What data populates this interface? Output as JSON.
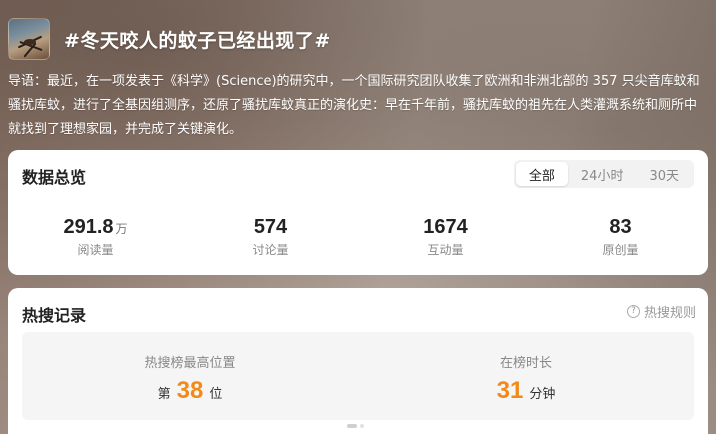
{
  "header": {
    "title": "#冬天咬人的蚊子已经出现了#",
    "thumbnail_icon": "mosquito-image"
  },
  "intro": "导语：最近，在一项发表于《科学》(Science)的研究中，一个国际研究团队收集了欧洲和非洲北部的 357 只尖音库蚊和骚扰库蚊，进行了全基因组测序，还原了骚扰库蚊真正的演化史：早在千年前，骚扰库蚊的祖先在人类灌溉系统和厕所中就找到了理想家园，并完成了关键演化。",
  "overview": {
    "title": "数据总览",
    "tabs": [
      "全部",
      "24小时",
      "30天"
    ],
    "active_tab": "全部",
    "stats": [
      {
        "value": "291.8",
        "unit": "万",
        "label": "阅读量"
      },
      {
        "value": "574",
        "unit": "",
        "label": "讨论量"
      },
      {
        "value": "1674",
        "unit": "",
        "label": "互动量"
      },
      {
        "value": "83",
        "unit": "",
        "label": "原创量"
      }
    ]
  },
  "hot": {
    "title": "热搜记录",
    "rules_link": "热搜规则",
    "rules_icon": "question-circle-icon",
    "peak": {
      "label": "热搜榜最高位置",
      "prefix": "第",
      "value": "38",
      "suffix": "位"
    },
    "duration": {
      "label": "在榜时长",
      "value": "31",
      "suffix": "分钟"
    }
  },
  "colors": {
    "accent_orange": "#f28a1a",
    "card_bg": "#ffffff",
    "muted_text": "#888888"
  }
}
